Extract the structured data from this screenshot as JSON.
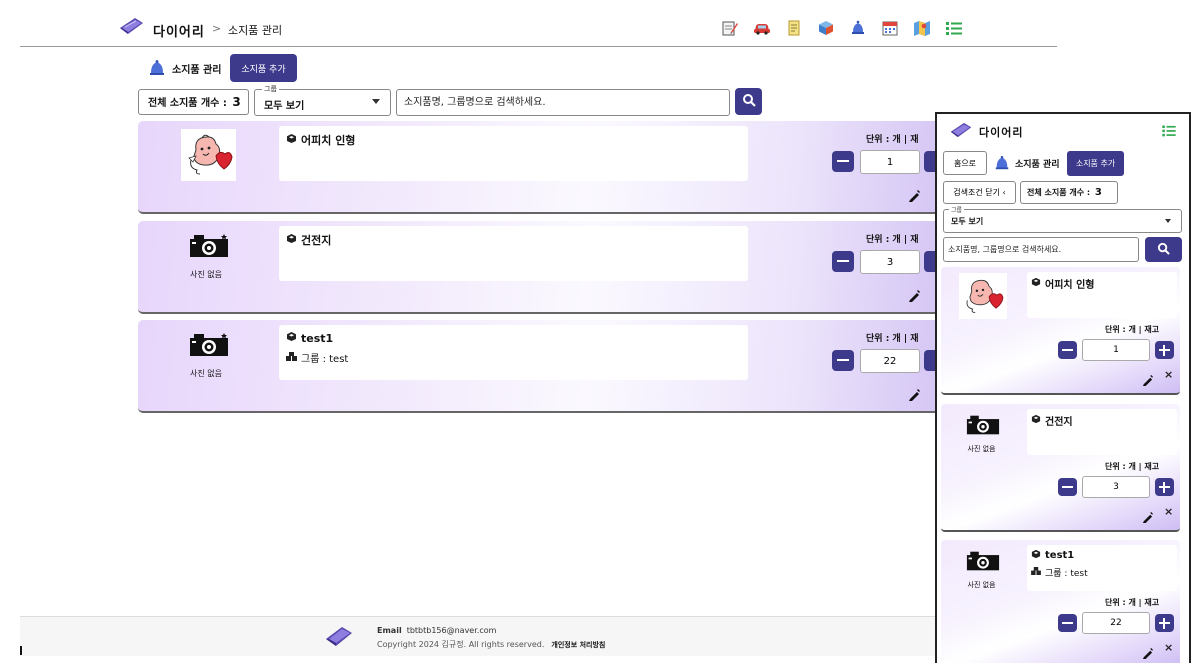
{
  "app": {
    "brand": "다이어리",
    "breadcrumb_sep": ">",
    "breadcrumb_current": "소지품 관리"
  },
  "topnav": [
    {
      "icon": "memo-icon"
    },
    {
      "icon": "car-icon"
    },
    {
      "icon": "document-icon"
    },
    {
      "icon": "cube-icon"
    },
    {
      "icon": "bell-icon"
    },
    {
      "icon": "calendar-icon"
    },
    {
      "icon": "map-icon"
    },
    {
      "icon": "list-icon"
    }
  ],
  "section": {
    "title": "소지품 관리",
    "add_button": "소지품 추가"
  },
  "filter": {
    "count_label": "전체 소지품 개수 :",
    "count_value": "3",
    "group_label": "그룹",
    "group_value": "모두 보기",
    "search_placeholder": "소지품명, 그룹명으로 검색하세요."
  },
  "items": [
    {
      "name": "어피치 인형",
      "group": "",
      "unit_label": "단위 : 개 | 재고",
      "quantity": "1",
      "photo": "apeach-doll"
    },
    {
      "name": "건전지",
      "group": "",
      "unit_label": "단위 : 개 | 재고",
      "quantity": "3",
      "photo": "camera-placeholder",
      "no_photo_label": "사진 없음"
    },
    {
      "name": "test1",
      "group": "그룹 : test",
      "unit_label": "단위 : 개 | 재고",
      "quantity": "22",
      "photo": "camera-placeholder",
      "no_photo_label": "사진 없음"
    }
  ],
  "unit_label_truncated": "단위 : 개 | 재",
  "footer": {
    "email_label": "Email",
    "email": "tbtbtb156@naver.com",
    "copyright": "Copyright 2024 김규정. All rights reserved.",
    "privacy": "개인정보 처리방침"
  },
  "mobile": {
    "home_button": "홈으로",
    "close_filter_button": "검색조건 닫기 ‹"
  },
  "colors": {
    "accent": "#3d3a8c",
    "card_gradient_start": "#e7d6fb",
    "card_gradient_end": "#d2c2f3"
  }
}
